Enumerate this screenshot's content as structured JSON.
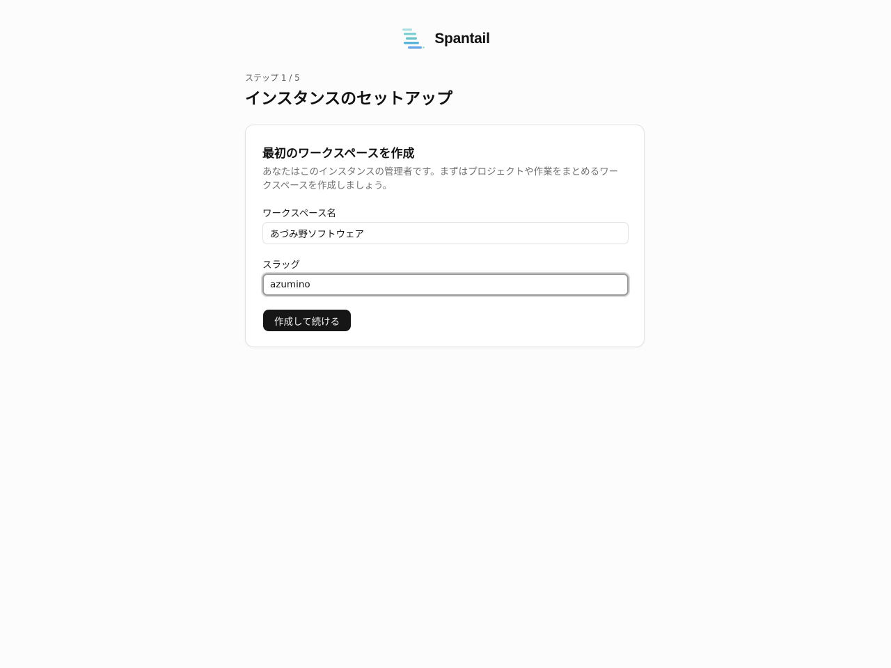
{
  "brand": {
    "name": "Spantail",
    "logo_icon": "stacked-bars-logo-icon",
    "logo_colors": [
      "#a8dfe0",
      "#7fd0d3",
      "#6cc4c7",
      "#59b6d8",
      "#6aa8e8"
    ]
  },
  "header": {
    "step": "ステップ 1 / 5",
    "title": "インスタンスのセットアップ"
  },
  "card": {
    "title": "最初のワークスペースを作成",
    "description": "あなたはこのインスタンスの管理者です。まずはプロジェクトや作業をまとめるワークスペースを作成しましょう。",
    "fields": {
      "workspace_name": {
        "label": "ワークスペース名",
        "value": "あづみ野ソフトウェア"
      },
      "slug": {
        "label": "スラッグ",
        "value": "azumino",
        "focused": true
      }
    },
    "submit_label": "作成して続ける"
  }
}
